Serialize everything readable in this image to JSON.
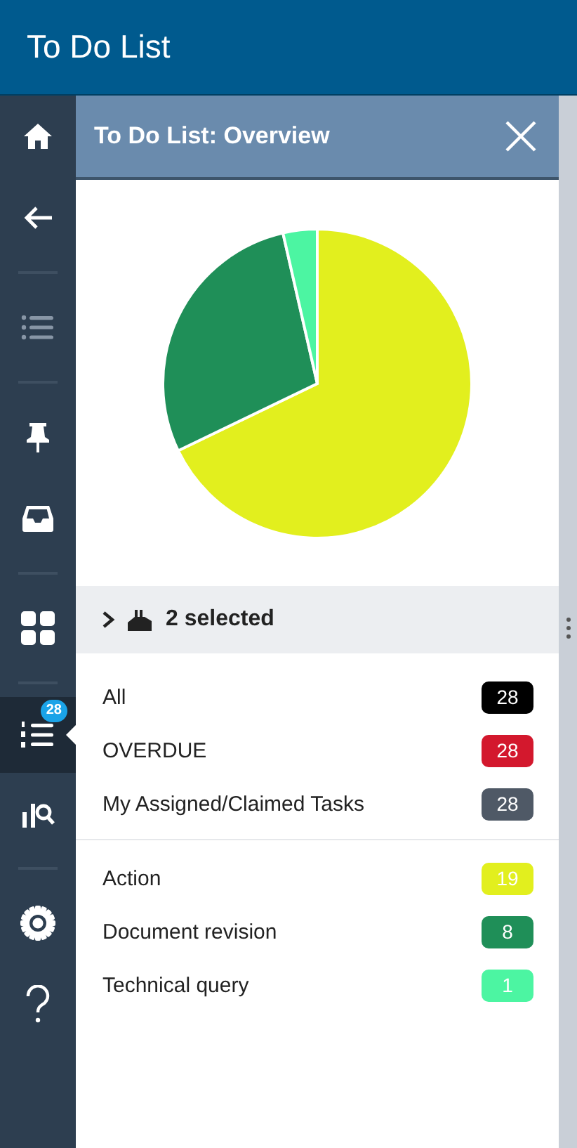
{
  "app_bar": {
    "title": "To Do List"
  },
  "sidebar": {
    "items": [
      {
        "kind": "home",
        "selected": false
      },
      {
        "kind": "back",
        "selected": false
      },
      {
        "kind": "divider"
      },
      {
        "kind": "list",
        "selected": false
      },
      {
        "kind": "divider"
      },
      {
        "kind": "pin",
        "selected": false
      },
      {
        "kind": "inbox",
        "selected": false
      },
      {
        "kind": "divider"
      },
      {
        "kind": "grid",
        "selected": false
      },
      {
        "kind": "divider"
      },
      {
        "kind": "numbered",
        "selected": true,
        "badge": "28"
      },
      {
        "kind": "analytics",
        "selected": false
      },
      {
        "kind": "divider"
      },
      {
        "kind": "settings",
        "selected": false
      },
      {
        "kind": "help",
        "selected": false
      }
    ]
  },
  "panel": {
    "title": "To Do List: Overview",
    "filter": {
      "expanded": false,
      "label": "2 selected"
    },
    "groups": [
      {
        "kind": "status",
        "items": [
          {
            "label": "All",
            "count": "28",
            "color": "#000000"
          },
          {
            "label": "OVERDUE",
            "count": "28",
            "color": "#d3182d"
          },
          {
            "label": "My Assigned/Claimed Tasks",
            "count": "28",
            "color": "#4f5966"
          }
        ]
      },
      {
        "kind": "chart",
        "items": [
          {
            "label": "Action",
            "count": "19",
            "color": "#e2ef1e"
          },
          {
            "label": "Document revision",
            "count": "8",
            "color": "#1f8f58"
          },
          {
            "label": "Technical query",
            "count": "1",
            "color": "#4cf5a2"
          }
        ]
      }
    ]
  }
}
